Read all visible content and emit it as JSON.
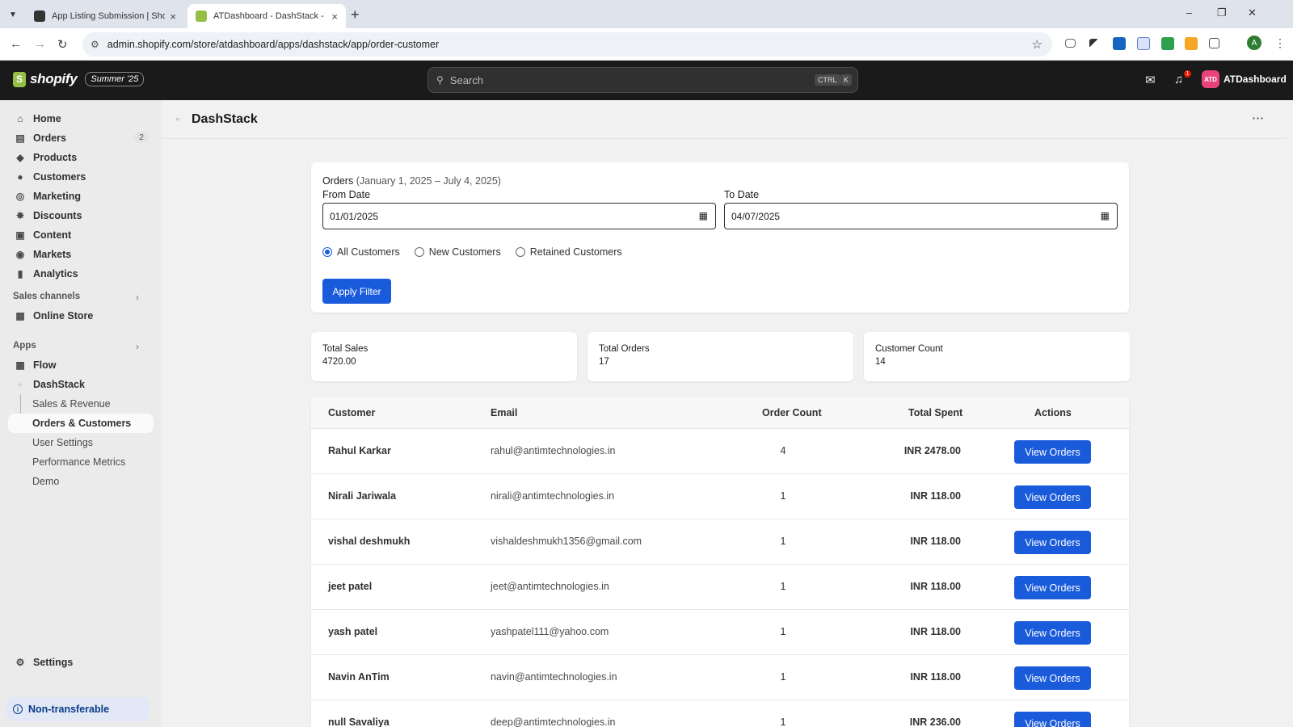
{
  "browser": {
    "tabs": [
      {
        "title": "App Listing Submission | Shopify",
        "active": false
      },
      {
        "title": "ATDashboard - DashStack - Shopify",
        "active": true
      }
    ],
    "url": "admin.shopify.com/store/atdashboard/apps/dashstack/app/order-customer",
    "profile_initial": "A"
  },
  "topbar": {
    "brand": "shopify",
    "edition": "Summer '25",
    "search_placeholder": "Search",
    "shortcut_ctrl": "CTRL",
    "shortcut_key": "K",
    "notification_count": "1",
    "store_initials": "ATD",
    "store_name": "ATDashboard"
  },
  "sidebar": {
    "items": [
      {
        "label": "Home",
        "icon": "home-icon"
      },
      {
        "label": "Orders",
        "icon": "orders-icon",
        "badge": "2"
      },
      {
        "label": "Products",
        "icon": "tag-icon"
      },
      {
        "label": "Customers",
        "icon": "person-icon"
      },
      {
        "label": "Marketing",
        "icon": "target-icon"
      },
      {
        "label": "Discounts",
        "icon": "discount-icon"
      },
      {
        "label": "Content",
        "icon": "content-icon"
      },
      {
        "label": "Markets",
        "icon": "globe-icon"
      },
      {
        "label": "Analytics",
        "icon": "bar-chart-icon"
      }
    ],
    "sales_channels_label": "Sales channels",
    "online_store": "Online Store",
    "apps_label": "Apps",
    "flow": "Flow",
    "dashstack": "DashStack",
    "app_subitems": [
      {
        "label": "Sales & Revenue",
        "active": false
      },
      {
        "label": "Orders & Customers",
        "active": true
      },
      {
        "label": "User Settings",
        "active": false
      },
      {
        "label": "Performance Metrics",
        "active": false
      },
      {
        "label": "Demo",
        "active": false
      }
    ],
    "settings": "Settings",
    "non_transferable": "Non-transferable"
  },
  "app": {
    "title": "DashStack",
    "filter": {
      "title": "Orders",
      "range": "(January 1, 2025 – July 4, 2025)",
      "from_label": "From Date",
      "from_value": "01/01/2025",
      "to_label": "To Date",
      "to_value": "04/07/2025",
      "options": [
        "All Customers",
        "New Customers",
        "Retained Customers"
      ],
      "selected": "All Customers",
      "apply_label": "Apply Filter"
    },
    "stats": [
      {
        "label": "Total Sales",
        "value": "4720.00"
      },
      {
        "label": "Total Orders",
        "value": "17"
      },
      {
        "label": "Customer Count",
        "value": "14"
      }
    ],
    "table": {
      "headers": [
        "Customer",
        "Email",
        "Order Count",
        "Total Spent",
        "Actions"
      ],
      "rows": [
        {
          "customer": "Rahul Karkar",
          "email": "rahul@antimtechnologies.in",
          "count": "4",
          "spent": "INR 2478.00",
          "action": "View Orders"
        },
        {
          "customer": "Nirali Jariwala",
          "email": "nirali@antimtechnologies.in",
          "count": "1",
          "spent": "INR 118.00",
          "action": "View Orders"
        },
        {
          "customer": "vishal deshmukh",
          "email": "vishaldeshmukh1356@gmail.com",
          "count": "1",
          "spent": "INR 118.00",
          "action": "View Orders"
        },
        {
          "customer": "jeet patel",
          "email": "jeet@antimtechnologies.in",
          "count": "1",
          "spent": "INR 118.00",
          "action": "View Orders"
        },
        {
          "customer": "yash patel",
          "email": "yashpatel111@yahoo.com",
          "count": "1",
          "spent": "INR 118.00",
          "action": "View Orders"
        },
        {
          "customer": "Navin AnTim",
          "email": "navin@antimtechnologies.in",
          "count": "1",
          "spent": "INR 118.00",
          "action": "View Orders"
        },
        {
          "customer": "null Savaliya",
          "email": "deep@antimtechnologies.in",
          "count": "1",
          "spent": "INR 236.00",
          "action": "View Orders"
        }
      ]
    }
  },
  "colors": {
    "primary": "#1a5bdb",
    "topbar": "#1a1a1a",
    "brand_green": "#95bf47",
    "store_avatar": "#e8447a"
  }
}
